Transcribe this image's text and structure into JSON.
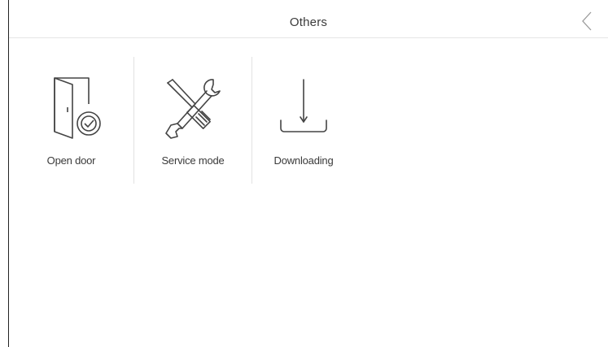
{
  "header": {
    "title": "Others",
    "back_icon": "chevron-left-icon"
  },
  "tiles": [
    {
      "label": "Open door",
      "icon": "open-door-icon"
    },
    {
      "label": "Service mode",
      "icon": "tools-icon"
    },
    {
      "label": "Downloading",
      "icon": "download-icon"
    }
  ],
  "colors": {
    "icon_stroke": "#444444",
    "divider": "#e2e2e2",
    "text": "#3a3a3a"
  }
}
